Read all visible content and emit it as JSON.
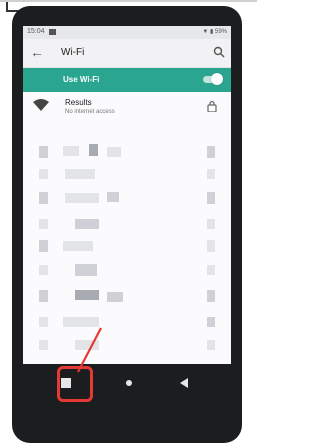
{
  "status_bar": {
    "time": "15:04",
    "battery": "59%"
  },
  "app_bar": {
    "title": "Wi-Fi"
  },
  "wifi_toggle": {
    "label": "Use Wi-Fi",
    "on": true
  },
  "results": {
    "title": "Results",
    "subtitle": "No internet access"
  },
  "colors": {
    "accent": "#2aa58f",
    "highlight": "#e53935"
  },
  "icons": [
    "back-arrow-icon",
    "search-icon",
    "wifi-icon",
    "lock-icon",
    "recents-square-icon",
    "home-dot-icon",
    "back-triangle-icon"
  ]
}
